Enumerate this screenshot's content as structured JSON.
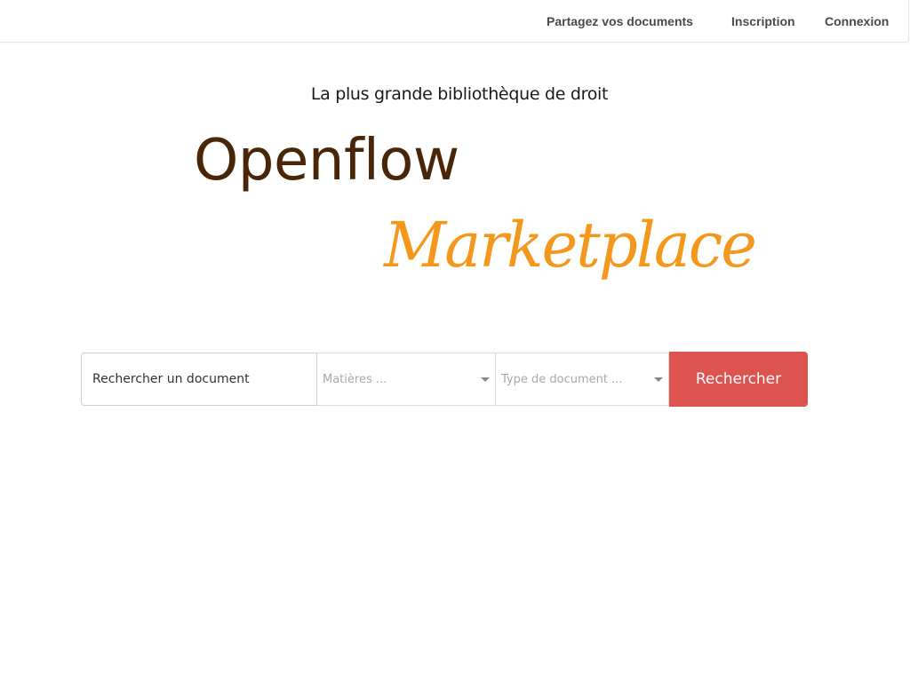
{
  "nav": {
    "share_label": "Partagez vos documents",
    "signup_label": "Inscription",
    "login_label": "Connexion"
  },
  "hero": {
    "tagline": "La plus grande bibliothèque de droit",
    "brand_main": "Openflow",
    "brand_sub": "Marketplace"
  },
  "search": {
    "input_placeholder": "Rechercher un document",
    "subjects_placeholder": "Matières ...",
    "doctype_placeholder": "Type de document ...",
    "button_label": "Rechercher"
  },
  "colors": {
    "brand_main": "#4a2608",
    "brand_sub": "#f3981c",
    "search_button": "#dd5350",
    "nav_text": "#4a4a4a"
  }
}
